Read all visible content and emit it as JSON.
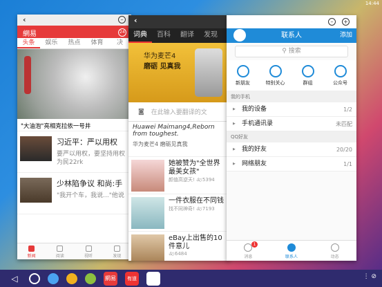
{
  "status": {
    "time": "14:44"
  },
  "w1": {
    "brand": "網易",
    "badge": "24",
    "tabs": [
      "头条",
      "娱乐",
      "热点",
      "体育",
      "决"
    ],
    "caption": "\"大油泡\"亮相克拉依一号井",
    "items": [
      {
        "title": "习近平：严以用权",
        "sub": "要严以用权，要坚持用权为民22rk"
      },
      {
        "title": "少林陷争议 和尚:手",
        "sub": "\"我开个车，我说...\"他说"
      }
    ],
    "nav": [
      "新闻",
      "阅读",
      "视听",
      "发现"
    ]
  },
  "w2": {
    "tabs": [
      "词典",
      "百科",
      "翻译",
      "发现"
    ],
    "ad_line1": "华为麦芒4",
    "ad_line2": "磨砺 见真我",
    "search_placeholder": "在此输入要翻译的文",
    "quote_en": "Huawei Maimang4,Reborn from toughest.",
    "quote_cn": "华为麦芒4 磨砺见真我",
    "items": [
      {
        "title": "她被赞为\"全世界最美女孩\"",
        "meta": "颜值高逆天! 🙵5394"
      },
      {
        "title": "一件衣服在不同钱",
        "meta": "找不同神奇! 🙵7193"
      },
      {
        "title": "eBay上出售的10件意儿",
        "meta": "🙵6484"
      }
    ]
  },
  "w3": {
    "title": "联系人",
    "add": "添加",
    "search": "搜索",
    "icons": [
      "新朋友",
      "特别关心",
      "群组",
      "公众号"
    ],
    "sect1": "我的手机",
    "rows1": [
      {
        "label": "我的设备",
        "cnt": "1/2"
      },
      {
        "label": "手机通讯录",
        "cnt": "未匹配"
      }
    ],
    "sect2": "QQ好友",
    "rows2": [
      {
        "label": "我的好友",
        "cnt": "20/20"
      },
      {
        "label": "网络朋友",
        "cnt": "1/1"
      }
    ],
    "nav": [
      "消息",
      "联系人",
      "动态"
    ],
    "badge": "1"
  },
  "taskbar": {
    "app1": "網易",
    "app2": "有道"
  }
}
